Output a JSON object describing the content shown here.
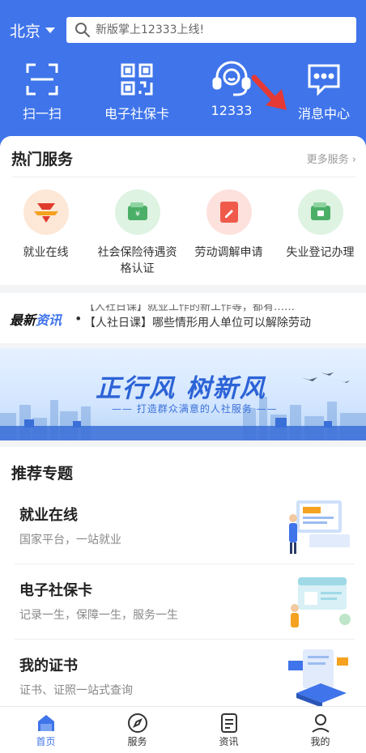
{
  "header": {
    "city": "北京",
    "search_placeholder": "新版掌上12333上线!",
    "quick_actions": [
      {
        "label": "扫一扫",
        "icon": "scan-icon"
      },
      {
        "label": "电子社保卡",
        "icon": "qr-code-icon"
      },
      {
        "label": "12333",
        "icon": "headset-icon"
      },
      {
        "label": "消息中心",
        "icon": "message-icon"
      }
    ]
  },
  "hot_services": {
    "title": "热门服务",
    "more": "更多服务 ›",
    "items": [
      {
        "label": "就业在线",
        "icon": "employment-logo-icon"
      },
      {
        "label": "社会保险待遇资格认证",
        "icon": "wallet-icon"
      },
      {
        "label": "劳动调解申请",
        "icon": "document-pen-icon"
      },
      {
        "label": "失业登记办理",
        "icon": "wallet-icon"
      }
    ]
  },
  "news": {
    "tag_a": "最新",
    "tag_b": "资讯",
    "line1": "【人社日课】就业工作的新工作等，都有……",
    "line2": "【人社日课】哪些情形用人单位可以解除劳动"
  },
  "banner": {
    "headline": "正行风 树新风",
    "subline": "—— 打造群众满意的人社服务 ——"
  },
  "recommend": {
    "title": "推荐专题",
    "items": [
      {
        "title": "就业在线",
        "subtitle": "国家平台，一站就业"
      },
      {
        "title": "电子社保卡",
        "subtitle": "记录一生，保障一生，服务一生"
      },
      {
        "title": "我的证书",
        "subtitle": "证书、证照一站式查询"
      }
    ]
  },
  "tabbar": [
    {
      "label": "首页",
      "icon": "home-icon",
      "active": true
    },
    {
      "label": "服务",
      "icon": "compass-icon",
      "active": false
    },
    {
      "label": "资讯",
      "icon": "news-icon",
      "active": false
    },
    {
      "label": "我的",
      "icon": "user-icon",
      "active": false
    }
  ],
  "colors": {
    "brand": "#3f74ea",
    "annotation_arrow": "#e53935"
  }
}
